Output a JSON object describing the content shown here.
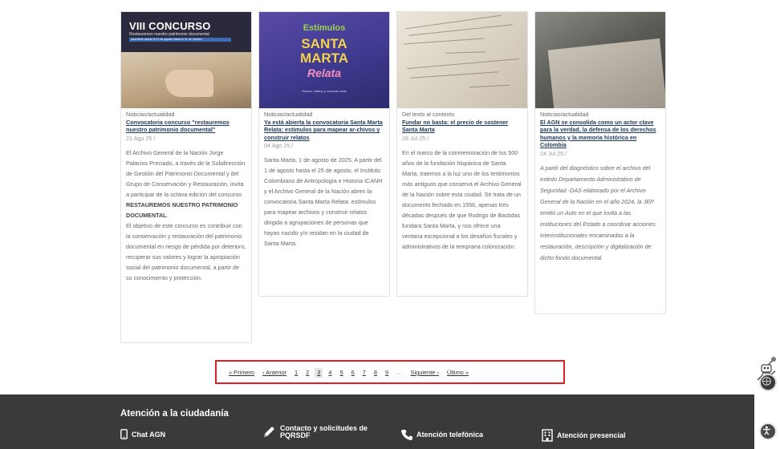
{
  "cards": [
    {
      "thumb": {
        "title": "VIII CONCURSO",
        "subtitle": "Restauremos nuestro patrimonio documental",
        "bar": "Inscríbete desde el 22 de agosto hasta el 31 de octubre"
      },
      "category": "Noticias/actualidad",
      "title": "Convocatoria concurso \"restauremos nuestro patrimonio documental\"",
      "date": "21 Ago 25 /",
      "paragraphs": [
        {
          "pre": "El Archivo General de la Nación Jorge Palacios Preciado, a través de la Subdirección de Gestión del Patrimonio Documental y del Grupo de Conservación y Restauración, invita a participar de la octava edición del concurso ",
          "bold": "RESTAUREMOS NUESTRO PATRIMONIO DOCUMENTAL",
          "post": "."
        },
        {
          "pre": "El objetivo de este concurso es contribuir con la conservación y restauración del patrimonio documental en riesgo de pérdida por deterioro, recuperar sus valores y lograr la apropiación social del patrimonio documental, a partir de su conocimiento y protección.",
          "bold": "",
          "post": ""
        }
      ]
    },
    {
      "thumb": {
        "line1": "Estímulos",
        "line2": "SANTA",
        "line3": "MARTA",
        "line4": "Relata",
        "footer": "Versos, relatos y crónicas vivas"
      },
      "category": "Noticias/actualidad",
      "title": "Ya está abierta la convocatoria Santa Marta Relata: estímulos para mapear ar-chivos y construir relatos",
      "date": "04 Ago 25 /",
      "text": "Santa Marta, 1 de agosto de 2025. A partir del 1 de agosto hasta el 25 de agosto, el Instituto Colombiano de Antropología e Historia ICANH y el Archivo General de la Nación abren la convocatoria Santa Marta Relata: estímulos para mapear archivos y construir relatos dirigida a agrupaciones de personas que hayan nacido y/o residan en la ciudad de Santa Marta."
    },
    {
      "category": "Del texto al contexto",
      "title": "Fundar no basta: el precio de sostener Santa Marta",
      "date": "28 Jul 25 /",
      "text": "En el marco de la conmemoración de los 500 años de la fundación hispánica de Santa Marta, traemos a la luz uno de los testimonios más antiguos que conserva el Archivo General de la Nación sobre esta ciudad. Se trata de un documento fechado en 1556, apenas tres décadas después de que Rodrigo de Bastidas fundara Santa Marta, y nos ofrece una ventana excepcional a los desafíos fiscales y administrativos de la temprana colonización."
    },
    {
      "category": "Noticias/actualidad",
      "title": "El AGN se consolida como un actor clave para la verdad, la defensa de los derechos humanos y la memoria histórica en Colombia",
      "date": "24 Jul 25 /",
      "text": "A partir del diagnóstico sobre el archivo del extinto Departamento Administrativo de Seguridad -DAS elaborado por el Archivo General de la Nación en el año 2024, la JEP emitió un Auto en el que invita a las instituciones del Estado a coordinar acciones interinstitucionales encaminadas a la restauración, descripción y digitalización de dicho fondo documental."
    }
  ],
  "pagination": {
    "first": "« Primero",
    "prev": "‹ Anterior",
    "pages": [
      "1",
      "2",
      "3",
      "4",
      "5",
      "6",
      "7",
      "8",
      "9"
    ],
    "current": "3",
    "ellipsis": "…",
    "next": "Siguiente ›",
    "last": "Último »"
  },
  "footer": {
    "heading": "Atención a la ciudadanía",
    "items": [
      {
        "label": "Chat AGN",
        "icon": "mobile-phone-icon"
      },
      {
        "label": "Contacto y solicitudes de PQRSDF",
        "icon": "pencil-icon"
      },
      {
        "label": "Atención telefónica",
        "icon": "phone-icon"
      },
      {
        "label": "Atención presencial",
        "icon": "building-icon"
      }
    ]
  },
  "colors": {
    "footer_bg": "#3a3a3a",
    "link": "#1f3a5a",
    "highlight_border": "#e02020"
  }
}
